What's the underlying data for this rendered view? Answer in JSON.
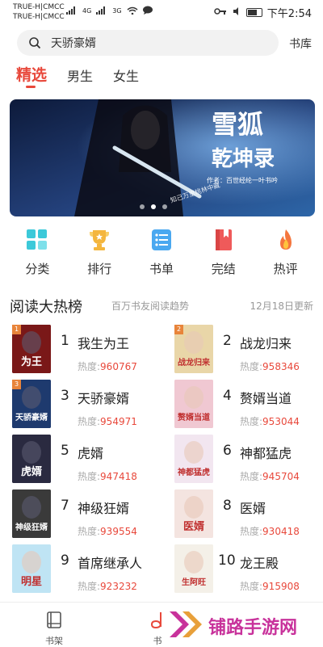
{
  "status_bar": {
    "carrier1": "TRUE-H|CMCC",
    "carrier2": "TRUE-H|CMCC",
    "net1": "4G",
    "net2": "3G",
    "time": "下午2:54"
  },
  "search": {
    "query": "天骄豪婿",
    "shelf_label": "书库"
  },
  "tabs": [
    "精选",
    "男生",
    "女生"
  ],
  "banner": {
    "title1": "雪狐",
    "title2": "乾坤录",
    "author": "作者：百世经纶一叶书吟",
    "small_text": "知己万里桃林中藏"
  },
  "categories": [
    {
      "label": "分类",
      "icon": "grid-icon",
      "color": "#3cc9d9"
    },
    {
      "label": "排行",
      "icon": "trophy-icon",
      "color": "#f4b63e"
    },
    {
      "label": "书单",
      "icon": "list-icon",
      "color": "#4aa8f0"
    },
    {
      "label": "完结",
      "icon": "book-icon",
      "color": "#ef5a5a"
    },
    {
      "label": "热评",
      "icon": "flame-icon",
      "color": "#f4763e"
    }
  ],
  "section": {
    "title": "阅读大热榜",
    "subtitle": "百万书友阅读趋势",
    "date": "12月18日更新"
  },
  "heat_label": "热度:",
  "ranking": [
    {
      "rank": "1",
      "title": "我生为王",
      "heat": "960767",
      "badge": "1",
      "cover_text": "为王",
      "cover_color": "#7a1818"
    },
    {
      "rank": "2",
      "title": "战龙归来",
      "heat": "958346",
      "badge": "2",
      "cover_text": "战龙归来",
      "cover_color": "#e9d6a8"
    },
    {
      "rank": "3",
      "title": "天骄豪婿",
      "heat": "954971",
      "badge": "3",
      "cover_text": "天骄豪婿",
      "cover_color": "#1e3a6e"
    },
    {
      "rank": "4",
      "title": "赘婿当道",
      "heat": "953044",
      "badge": "",
      "cover_text": "赘婿当道",
      "cover_color": "#f0c8d2"
    },
    {
      "rank": "5",
      "title": "虎婿",
      "heat": "947418",
      "badge": "",
      "cover_text": "虎婿",
      "cover_color": "#2a2a40"
    },
    {
      "rank": "6",
      "title": "神都猛虎",
      "heat": "945704",
      "badge": "",
      "cover_text": "神都猛虎",
      "cover_color": "#f2e6f0"
    },
    {
      "rank": "7",
      "title": "神级狂婿",
      "heat": "939554",
      "badge": "",
      "cover_text": "神级狂婿",
      "cover_color": "#3a3a3a"
    },
    {
      "rank": "8",
      "title": "医婿",
      "heat": "930418",
      "badge": "",
      "cover_text": "医婿",
      "cover_color": "#f4e4e0"
    },
    {
      "rank": "9",
      "title": "首席继承人",
      "heat": "923232",
      "badge": "",
      "cover_text": "明星",
      "cover_color": "#bfe4f4"
    },
    {
      "rank": "10",
      "title": "龙王殿",
      "heat": "915908",
      "badge": "",
      "cover_text": "生阿旺",
      "cover_color": "#f4f0e8"
    }
  ],
  "bottom_nav": [
    {
      "label": "书架",
      "icon": "bookshelf-icon"
    },
    {
      "label": "书",
      "icon": "bookstore-icon"
    }
  ],
  "watermark": "铺路手游网"
}
